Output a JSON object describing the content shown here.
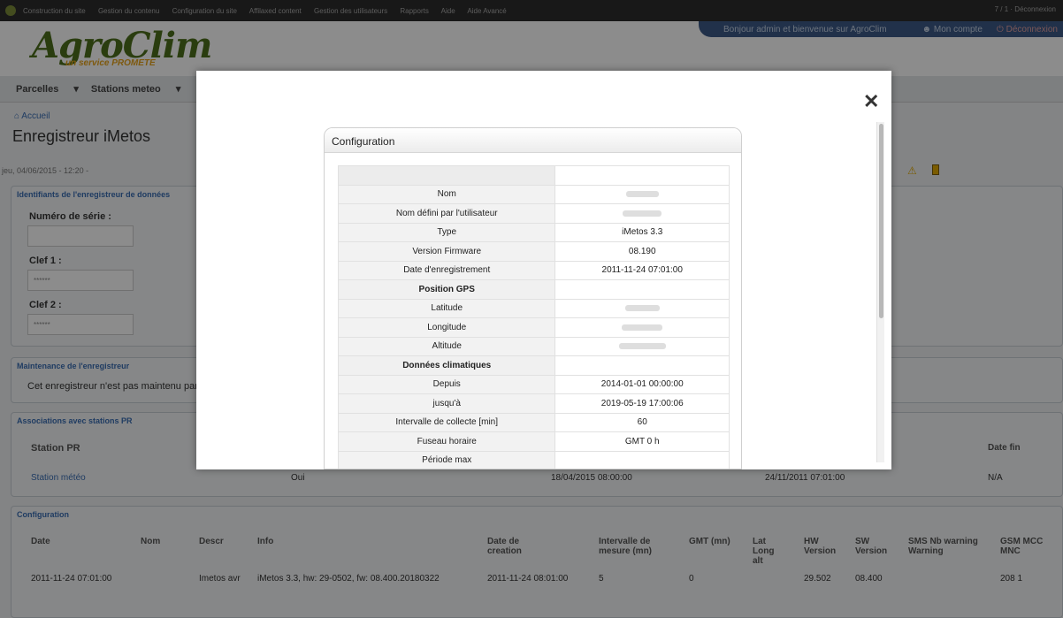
{
  "admin_bar": {
    "links": [
      "Construction du site",
      "Gestion du contenu",
      "Configuration du site",
      "Affilaxed content",
      "Gestion des utilisateurs",
      "Rapports",
      "Aide",
      "Aide Avancé"
    ],
    "right_text": "7 / 1 · Déconnexion"
  },
  "header": {
    "logo_title": "AgroClim",
    "logo_subtitle": "un service PROMETE",
    "welcome": "Bonjour admin et bienvenue sur AgroClim",
    "account": "Mon compte",
    "logout": "Déconnexion"
  },
  "nav": {
    "items": [
      "Parcelles",
      "Stations meteo"
    ]
  },
  "page": {
    "breadcrumb": "Accueil",
    "title": "Enregistreur iMetos",
    "date_line": "jeu, 04/06/2015 - 12:20 -"
  },
  "identifiants": {
    "title": "Identifiants de l'enregistreur de données",
    "serial_label": "Numéro de série :",
    "key1_label": "Clef 1 :",
    "key1_value": "******",
    "key2_label": "Clef 2 :",
    "key2_value": "******"
  },
  "maintenance": {
    "title": "Maintenance de l'enregistreur",
    "text": "Cet enregistreur n'est pas maintenu par"
  },
  "associations": {
    "title": "Associations avec stations PR",
    "col_station": "Station PR",
    "col_date_fin": "Date fin",
    "row_station": "Station météo",
    "row_oui": "Oui",
    "row_date_debut": "18/04/2015 08:00:00",
    "row_date_install": "24/11/2011 07:01:00",
    "row_fin": "N/A"
  },
  "config_section": {
    "title": "Configuration",
    "headers": [
      "Date",
      "Nom",
      "Descr",
      "Info",
      "Date de creation",
      "Intervalle de mesure (mn)",
      "GMT (mn)",
      "Lat Long alt",
      "HW Version",
      "SW Version",
      "SMS Nb warning Warning",
      "GSM MCC MNC"
    ],
    "row": [
      "2011-11-24 07:01:00",
      "",
      "Imetos avr",
      "iMetos 3.3, hw: 29-0502, fw: 08.400.20180322",
      "2011-11-24 08:01:00",
      "5",
      "0",
      "",
      "29.502",
      "08.400",
      "",
      "208 1"
    ]
  },
  "modal": {
    "close_symbol": "✕",
    "box_title": "Configuration",
    "rows": [
      {
        "key": "",
        "value": "",
        "type": "first"
      },
      {
        "key": "Nom",
        "value": "",
        "type": "row",
        "blurred": true
      },
      {
        "key": "Nom défini par l'utilisateur",
        "value": "",
        "type": "row",
        "blurred": true
      },
      {
        "key": "Type",
        "value": "iMetos 3.3",
        "type": "row"
      },
      {
        "key": "Version Firmware",
        "value": "08.190",
        "type": "row"
      },
      {
        "key": "Date d'enregistrement",
        "value": "2011-11-24 07:01:00",
        "type": "row"
      },
      {
        "key": "Position GPS",
        "value": "",
        "type": "section"
      },
      {
        "key": "Latitude",
        "value": "",
        "type": "row",
        "blurred": true
      },
      {
        "key": "Longitude",
        "value": "",
        "type": "row",
        "blurred": true
      },
      {
        "key": "Altitude",
        "value": "",
        "type": "row",
        "blurred": true
      },
      {
        "key": "Données climatiques",
        "value": "",
        "type": "section"
      },
      {
        "key": "Depuis",
        "value": "2014-01-01 00:00:00",
        "type": "row"
      },
      {
        "key": "jusqu'à",
        "value": "2019-05-19 17:00:06",
        "type": "row"
      },
      {
        "key": "Intervalle de collecte [min]",
        "value": "60",
        "type": "row"
      },
      {
        "key": "Fuseau horaire",
        "value": "GMT 0 h",
        "type": "row"
      },
      {
        "key": "Période max",
        "value": "",
        "type": "row"
      }
    ]
  },
  "colors": {
    "overlay": "#000000",
    "logo_green": "#4e6f1c",
    "logo_orange": "#e6a21a",
    "link_blue": "#3a6db3"
  }
}
